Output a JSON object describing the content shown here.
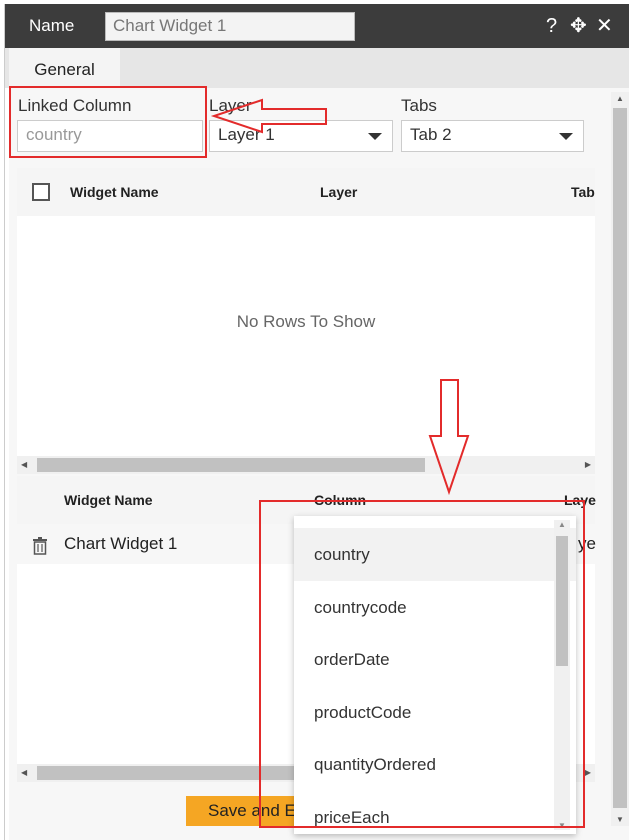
{
  "titlebar": {
    "name_label": "Name",
    "name_value": "Chart Widget 1",
    "help_icon": "?",
    "move_icon": "✥",
    "close_icon": "✕"
  },
  "tabs": [
    {
      "label": "General"
    }
  ],
  "linked_column": {
    "label": "Linked Column",
    "value": "country"
  },
  "layer": {
    "label": "Layer",
    "value": "Layer 1"
  },
  "tabs_field": {
    "label": "Tabs",
    "value": "Tab 2"
  },
  "grid1": {
    "columns": [
      "Widget Name",
      "Layer",
      "Tab"
    ],
    "empty_text": "No Rows To Show"
  },
  "grid2": {
    "columns": [
      "Widget Name",
      "Column",
      "Laye"
    ],
    "rows": [
      {
        "widget_name": "Chart Widget 1",
        "layer_partial": "ye"
      }
    ]
  },
  "save_button": {
    "label": "Save and E"
  },
  "dropdown": {
    "options": [
      "country",
      "countrycode",
      "orderDate",
      "productCode",
      "quantityOrdered",
      "priceEach"
    ],
    "selected": "country"
  },
  "colors": {
    "accent": "#f5a623",
    "annotation": "#e32b2b",
    "titlebar": "#3c3c3c"
  }
}
